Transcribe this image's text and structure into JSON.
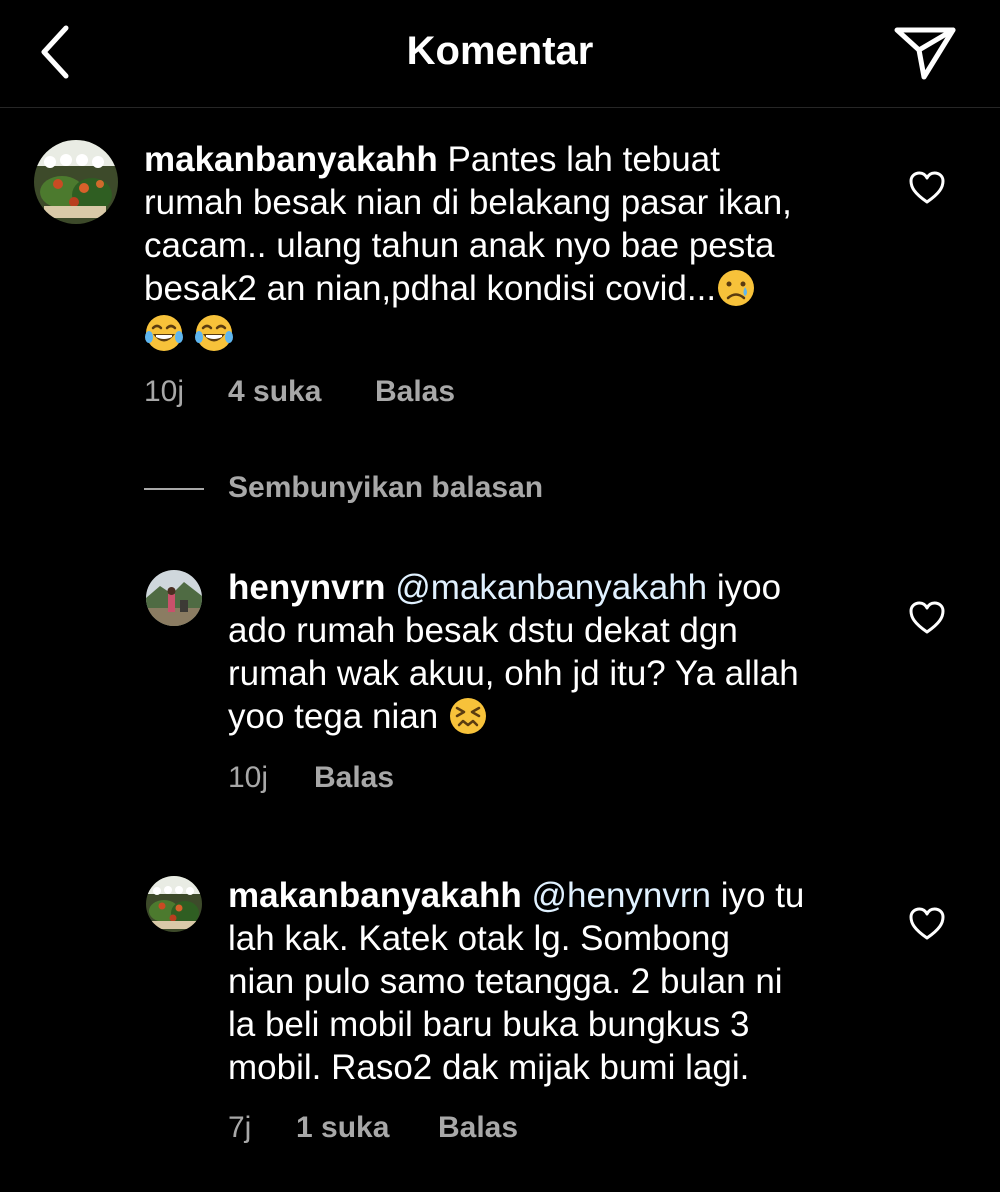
{
  "header": {
    "title": "Komentar",
    "back_icon": "chevron-left-icon",
    "send_icon": "paper-plane-icon"
  },
  "comments": [
    {
      "username": "makanbanyakahh",
      "lines": [
        "Pantes lah tebuat",
        "rumah besak nian di belakang pasar ikan,",
        "cacam.. ulang tahun anak nyo bae pesta",
        "besak2 an nian,pdhal kondisi covid..."
      ],
      "emojis": [
        "crying-face-emoji",
        "tears-of-joy-emoji",
        "tears-of-joy-emoji"
      ],
      "time": "10j",
      "likes": "4 suka",
      "reply": "Balas"
    }
  ],
  "hide_replies": "Sembunyikan balasan",
  "replies": [
    {
      "username": "henynvrn",
      "mention": "@makanbanyakahh",
      "lines": [
        "iyoo",
        "ado rumah besak dstu dekat dgn",
        "rumah wak akuu, ohh jd itu? Ya allah",
        "yoo tega nian"
      ],
      "emojis": [
        "confounded-face-emoji"
      ],
      "time": "10j",
      "reply": "Balas"
    },
    {
      "username": "makanbanyakahh",
      "mention": "@henynvrn",
      "lines": [
        "iyo tu",
        "lah kak. Katek otak lg. Sombong",
        "nian pulo samo tetangga. 2 bulan ni",
        "la beli mobil baru buka bungkus 3",
        "mobil. Raso2 dak mijak bumi lagi."
      ],
      "time": "7j",
      "likes": "1 suka",
      "reply": "Balas"
    }
  ],
  "colors": {
    "background": "#000000",
    "text": "#ffffff",
    "secondary": "#a8a8a8",
    "mention": "#e0f1ff",
    "divider": "#262626"
  }
}
